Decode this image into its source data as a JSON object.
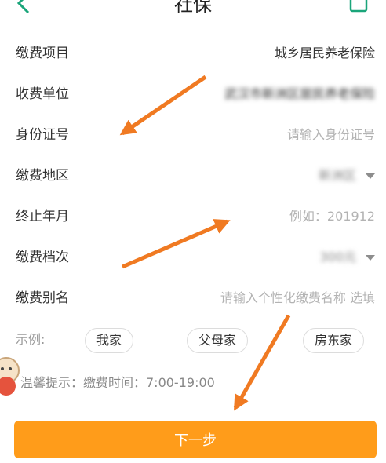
{
  "header": {
    "title": "社保"
  },
  "form": {
    "rows": [
      {
        "label": "缴费项目",
        "value": "城乡居民养老保险"
      },
      {
        "label": "收费单位",
        "value": "武汉市新洲区居民养老保险"
      },
      {
        "label": "身份证号",
        "placeholder": "请输入身份证号"
      },
      {
        "label": "缴费地区",
        "value": "新洲区"
      },
      {
        "label": "终止年月",
        "placeholder": "例如：201912"
      },
      {
        "label": "缴费档次",
        "value": "300元"
      },
      {
        "label": "缴费别名",
        "placeholder": "请输入个性化缴费名称 选填"
      }
    ]
  },
  "examples": {
    "label": "示例:",
    "chips": [
      "我家",
      "父母家",
      "房东家"
    ]
  },
  "tip": "温馨提示：缴费时间：7:00-19:00",
  "footer": {
    "next_label": "下一步"
  },
  "colors": {
    "accent": "#ff9c1a",
    "arrow": "#f07a22"
  }
}
